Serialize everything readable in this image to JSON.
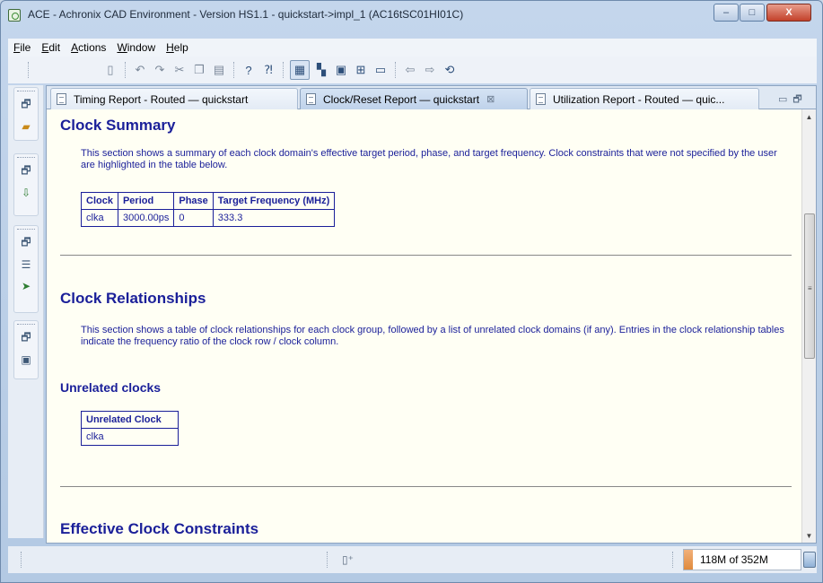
{
  "window": {
    "title": "ACE - Achronix CAD Environment - Version HS1.1 - quickstart->impl_1 (AC16tSC01HI01C)",
    "minimize": "–",
    "maximize": "□",
    "close": "X"
  },
  "menu": [
    "File",
    "Edit",
    "Actions",
    "Window",
    "Help"
  ],
  "toolbar": {
    "icons": [
      "page-icon",
      "back-arrow-icon",
      "forward-arrow-icon",
      "cut-icon",
      "copy-icon",
      "paste-icon",
      "help-icon",
      "whats-this-icon",
      "layout-icon",
      "layout-alt-icon",
      "run-icon",
      "flow-icon",
      "message-icon",
      "nav-back-icon",
      "nav-forward-icon",
      "sync-icon"
    ]
  },
  "tabs": [
    {
      "label": "Timing Report - Routed — quickstart",
      "active": false
    },
    {
      "label": "Clock/Reset Report — quickstart",
      "active": true,
      "close": "⊠"
    },
    {
      "label": "Utilization Report - Routed — quic...",
      "active": false
    }
  ],
  "report": {
    "clock_summary": {
      "heading": "Clock Summary",
      "description": "This section shows a summary of each clock domain's effective target period, phase, and target frequency. Clock constraints that were not specified by the user are highlighted in the table below.",
      "columns": [
        "Clock",
        "Period",
        "Phase",
        "Target Frequency (MHz)"
      ],
      "rows": [
        [
          "clka",
          "3000.00ps",
          "0",
          "333.3"
        ]
      ]
    },
    "clock_relationships": {
      "heading": "Clock Relationships",
      "description": "This section shows a table of clock relationships for each clock group, followed by a list of unrelated clock domains (if any). Entries in the clock relationship tables indicate the frequency ratio of the clock row / clock column.",
      "unrelated_heading": "Unrelated clocks",
      "unrelated_columns": [
        "Unrelated Clock"
      ],
      "unrelated_rows": [
        [
          "clka"
        ]
      ]
    },
    "effective_constraints": {
      "heading": "Effective Clock Constraints"
    }
  },
  "statusbar": {
    "heap": "118M of 352M",
    "heap_fraction": 0.335
  },
  "colors": {
    "report_text": "#1a1f99",
    "report_bg": "#fffff4",
    "window_frame": "#b3c9e3"
  }
}
